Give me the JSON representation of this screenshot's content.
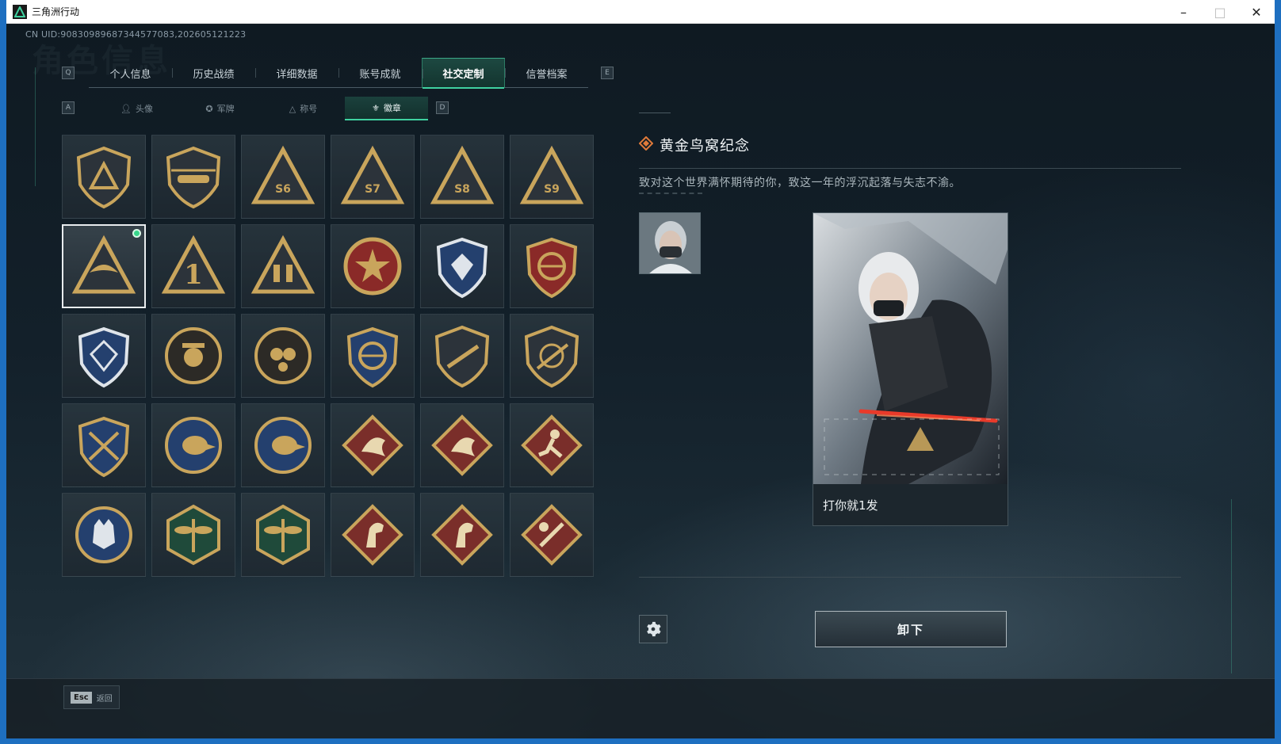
{
  "window": {
    "title": "三角洲行动",
    "minimize": "–",
    "maximize": "□",
    "close": "✕"
  },
  "uid": "CN UID:90830989687344577083,202605121223",
  "background_title": "角色信息",
  "tab_keys": {
    "prev": "Q",
    "next": "E"
  },
  "tabs": [
    {
      "label": "个人信息",
      "active": false
    },
    {
      "label": "历史战绩",
      "active": false
    },
    {
      "label": "详细数据",
      "active": false
    },
    {
      "label": "账号成就",
      "active": false
    },
    {
      "label": "社交定制",
      "active": true
    },
    {
      "label": "信誉档案",
      "active": false
    }
  ],
  "subtab_keys": {
    "prev": "A",
    "next": "D"
  },
  "subtabs": [
    {
      "label": "头像",
      "icon": "person-icon",
      "active": false
    },
    {
      "label": "军牌",
      "icon": "dogtag-icon",
      "active": false
    },
    {
      "label": "称号",
      "icon": "title-icon",
      "active": false
    },
    {
      "label": "徽章",
      "icon": "badge-icon",
      "active": true
    }
  ],
  "badges": [
    {
      "icon": "delta-shield-badge-icon",
      "selected": false
    },
    {
      "icon": "helicopter-badge-icon",
      "selected": false
    },
    {
      "icon": "s6-season-badge-icon",
      "selected": false
    },
    {
      "icon": "s7-season-badge-icon",
      "selected": false
    },
    {
      "icon": "s8-season-badge-icon",
      "selected": false
    },
    {
      "icon": "s9-season-badge-icon",
      "selected": false
    },
    {
      "icon": "golden-nest-badge-icon",
      "selected": true,
      "equipped": true
    },
    {
      "icon": "number-one-badge-icon",
      "selected": false
    },
    {
      "icon": "soldiers-badge-icon",
      "selected": false
    },
    {
      "icon": "star-medal-badge-icon",
      "selected": false
    },
    {
      "icon": "blue-shield-badge-icon",
      "selected": false
    },
    {
      "icon": "red-shield-badge-icon",
      "selected": false
    },
    {
      "icon": "blue-crest-badge-icon",
      "selected": false
    },
    {
      "icon": "sniper-skull-badge-icon",
      "selected": false
    },
    {
      "icon": "gas-mask-badge-icon",
      "selected": false
    },
    {
      "icon": "crosshair-rifle-badge-icon",
      "selected": false
    },
    {
      "icon": "rifle-shield-badge-icon",
      "selected": false
    },
    {
      "icon": "scope-rifle-badge-icon",
      "selected": false
    },
    {
      "icon": "crossed-rifles-badge-icon",
      "selected": false
    },
    {
      "icon": "eagle-badge-icon",
      "selected": false
    },
    {
      "icon": "eagle-badge-icon",
      "selected": false
    },
    {
      "icon": "dragon-badge-icon",
      "selected": false
    },
    {
      "icon": "dragon-badge-icon",
      "selected": false
    },
    {
      "icon": "runner-badge-icon",
      "selected": false
    },
    {
      "icon": "wolf-badge-icon",
      "selected": false
    },
    {
      "icon": "dragonfly-badge-icon",
      "selected": false
    },
    {
      "icon": "dragonfly-badge-icon",
      "selected": false
    },
    {
      "icon": "horse-badge-icon",
      "selected": false
    },
    {
      "icon": "horse-badge-icon",
      "selected": false
    },
    {
      "icon": "weapon-badge-icon",
      "selected": false
    }
  ],
  "detail": {
    "name": "黄金鸟窝纪念",
    "description": "致对这个世界满怀期待的你，致这一年的浮沉起落与失志不渝。",
    "card_caption": "打你就1发",
    "unequip_label": "卸下"
  },
  "footer": {
    "esc_key": "Esc",
    "back_label": "返回"
  },
  "colors": {
    "accent": "#3fd1a0",
    "equipped": "#36d68a",
    "gold": "#c9a55c",
    "navy": "#24406e",
    "maroon": "#7a2e2a"
  }
}
